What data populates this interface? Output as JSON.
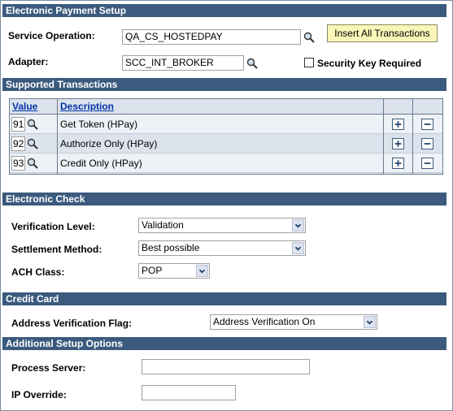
{
  "payment": {
    "title": "Electronic Payment Setup",
    "service_label": "Service Operation:",
    "service_value": "QA_CS_HOSTEDPAY",
    "insert_button": "Insert All Transactions",
    "adapter_label": "Adapter:",
    "adapter_value": "SCC_INT_BROKER",
    "security_label": "Security Key Required"
  },
  "transactions": {
    "title": "Supported Transactions",
    "col_value": "Value",
    "col_description": "Description",
    "rows": [
      {
        "value": "91",
        "description": "Get Token (HPay)"
      },
      {
        "value": "92",
        "description": "Authorize Only (HPay)"
      },
      {
        "value": "93",
        "description": "Credit Only (HPay)"
      }
    ]
  },
  "check": {
    "title": "Electronic Check",
    "verification_label": "Verification Level:",
    "verification_value": "Validation",
    "settlement_label": "Settlement Method:",
    "settlement_value": "Best possible",
    "ach_label": "ACH Class:",
    "ach_value": "POP"
  },
  "card": {
    "title": "Credit Card",
    "avs_label": "Address Verification Flag:",
    "avs_value": "Address Verification On"
  },
  "additional": {
    "title": "Additional Setup Options",
    "process_label": "Process Server:",
    "process_value": "",
    "ip_label": "IP Override:",
    "ip_value": ""
  },
  "colors": {
    "section_bar": "#3b5a7e",
    "grid_header": "#dde3ec",
    "button_fill": "#f9f6b8"
  }
}
